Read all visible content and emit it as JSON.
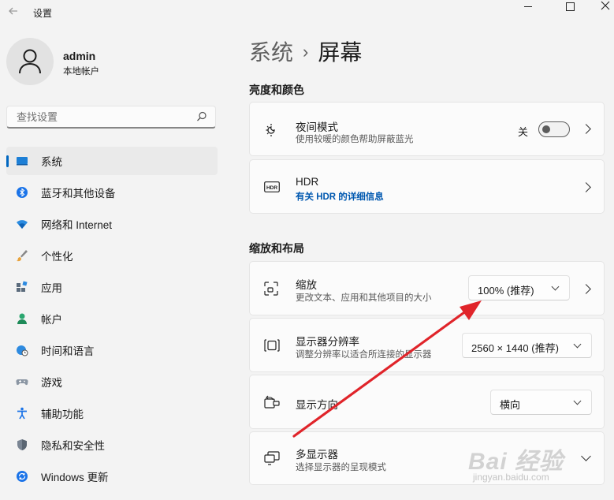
{
  "window": {
    "title": "设置"
  },
  "profile": {
    "name": "admin",
    "account_type": "本地帐户"
  },
  "search": {
    "placeholder": "查找设置"
  },
  "nav": {
    "items": [
      {
        "label": "系统",
        "icon": "system-icon",
        "active": true
      },
      {
        "label": "蓝牙和其他设备",
        "icon": "bluetooth-icon"
      },
      {
        "label": "网络和 Internet",
        "icon": "wifi-icon"
      },
      {
        "label": "个性化",
        "icon": "brush-icon"
      },
      {
        "label": "应用",
        "icon": "apps-icon"
      },
      {
        "label": "帐户",
        "icon": "account-icon"
      },
      {
        "label": "时间和语言",
        "icon": "globe-clock-icon"
      },
      {
        "label": "游戏",
        "icon": "gamepad-icon"
      },
      {
        "label": "辅助功能",
        "icon": "accessibility-icon"
      },
      {
        "label": "隐私和安全性",
        "icon": "shield-icon"
      },
      {
        "label": "Windows 更新",
        "icon": "update-icon"
      }
    ]
  },
  "breadcrumb": {
    "parent": "系统",
    "separator": "›",
    "current": "屏幕"
  },
  "sections": {
    "brightness_color": "亮度和颜色",
    "scale_layout": "缩放和布局"
  },
  "night_light": {
    "title": "夜间模式",
    "subtitle": "使用较暖的颜色帮助屏蔽蓝光",
    "state_label": "关",
    "on": false
  },
  "hdr": {
    "title": "HDR",
    "link": "有关 HDR 的详细信息"
  },
  "scale": {
    "title": "缩放",
    "subtitle": "更改文本、应用和其他项目的大小",
    "value": "100% (推荐)"
  },
  "resolution": {
    "title": "显示器分辨率",
    "subtitle": "调整分辨率以适合所连接的显示器",
    "value": "2560 × 1440 (推荐)"
  },
  "orientation": {
    "title": "显示方向",
    "value": "横向"
  },
  "multi_display": {
    "title": "多显示器",
    "subtitle": "选择显示器的呈现模式"
  },
  "watermark": {
    "brand": "Bai 经验",
    "url": "jingyan.baidu.com"
  },
  "colors": {
    "accent": "#0067c0",
    "annotation_arrow": "#e0242a"
  }
}
